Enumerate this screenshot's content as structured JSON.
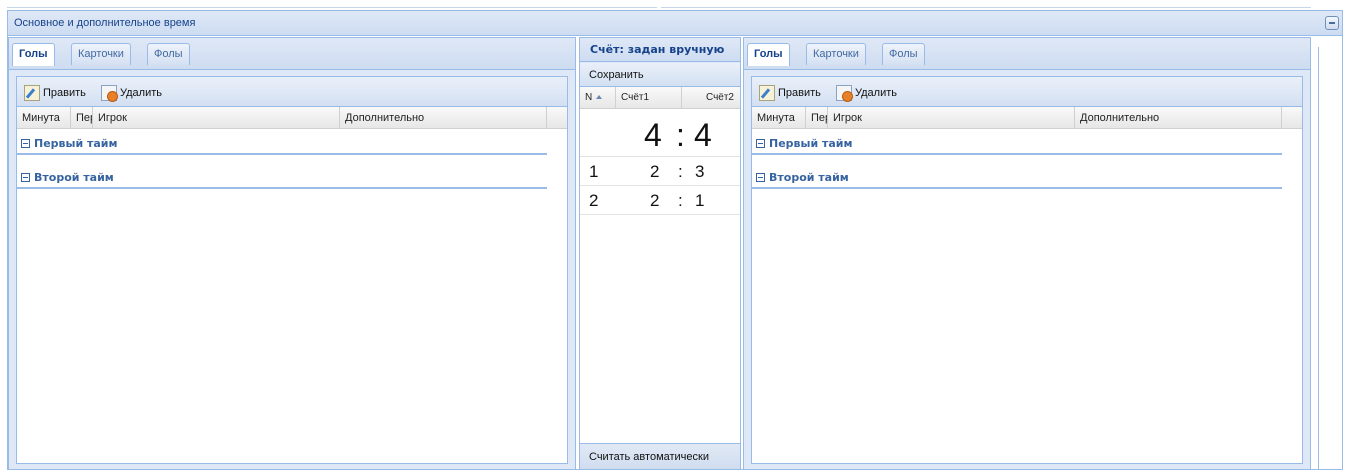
{
  "section": {
    "title": "Основное и дополнительное время"
  },
  "left_panel": {
    "tabs": [
      {
        "label": "Голы",
        "active": true
      },
      {
        "label": "Карточки",
        "active": false
      },
      {
        "label": "Фолы",
        "active": false
      }
    ],
    "toolbar": {
      "edit_label": "Править",
      "delete_label": "Удалить"
    },
    "columns": [
      "Минута",
      "Пер",
      "Игрок",
      "Дополнительно"
    ],
    "groups": [
      "Первый тайм",
      "Второй тайм"
    ]
  },
  "score_panel": {
    "title": "Счёт: задан вручную",
    "save_label": "Сохранить",
    "columns": [
      "N",
      "Счёт1",
      "Счёт2"
    ],
    "total": {
      "score1": "4",
      "score2": "4"
    },
    "rows": [
      {
        "n": "1",
        "score1": "2",
        "score2": "3"
      },
      {
        "n": "2",
        "score1": "2",
        "score2": "1"
      }
    ],
    "auto_label": "Считать автоматически"
  },
  "right_panel": {
    "tabs": [
      {
        "label": "Голы",
        "active": true
      },
      {
        "label": "Карточки",
        "active": false
      },
      {
        "label": "Фолы",
        "active": false
      }
    ],
    "toolbar": {
      "edit_label": "Править",
      "delete_label": "Удалить"
    },
    "columns": [
      "Минута",
      "Пер",
      "Игрок",
      "Дополнительно"
    ],
    "groups": [
      "Первый тайм",
      "Второй тайм"
    ]
  },
  "colors": {
    "accent": "#15428b",
    "border": "#99bbe8",
    "header_bg": "#dfe8f6",
    "group_text": "#3764a0"
  }
}
